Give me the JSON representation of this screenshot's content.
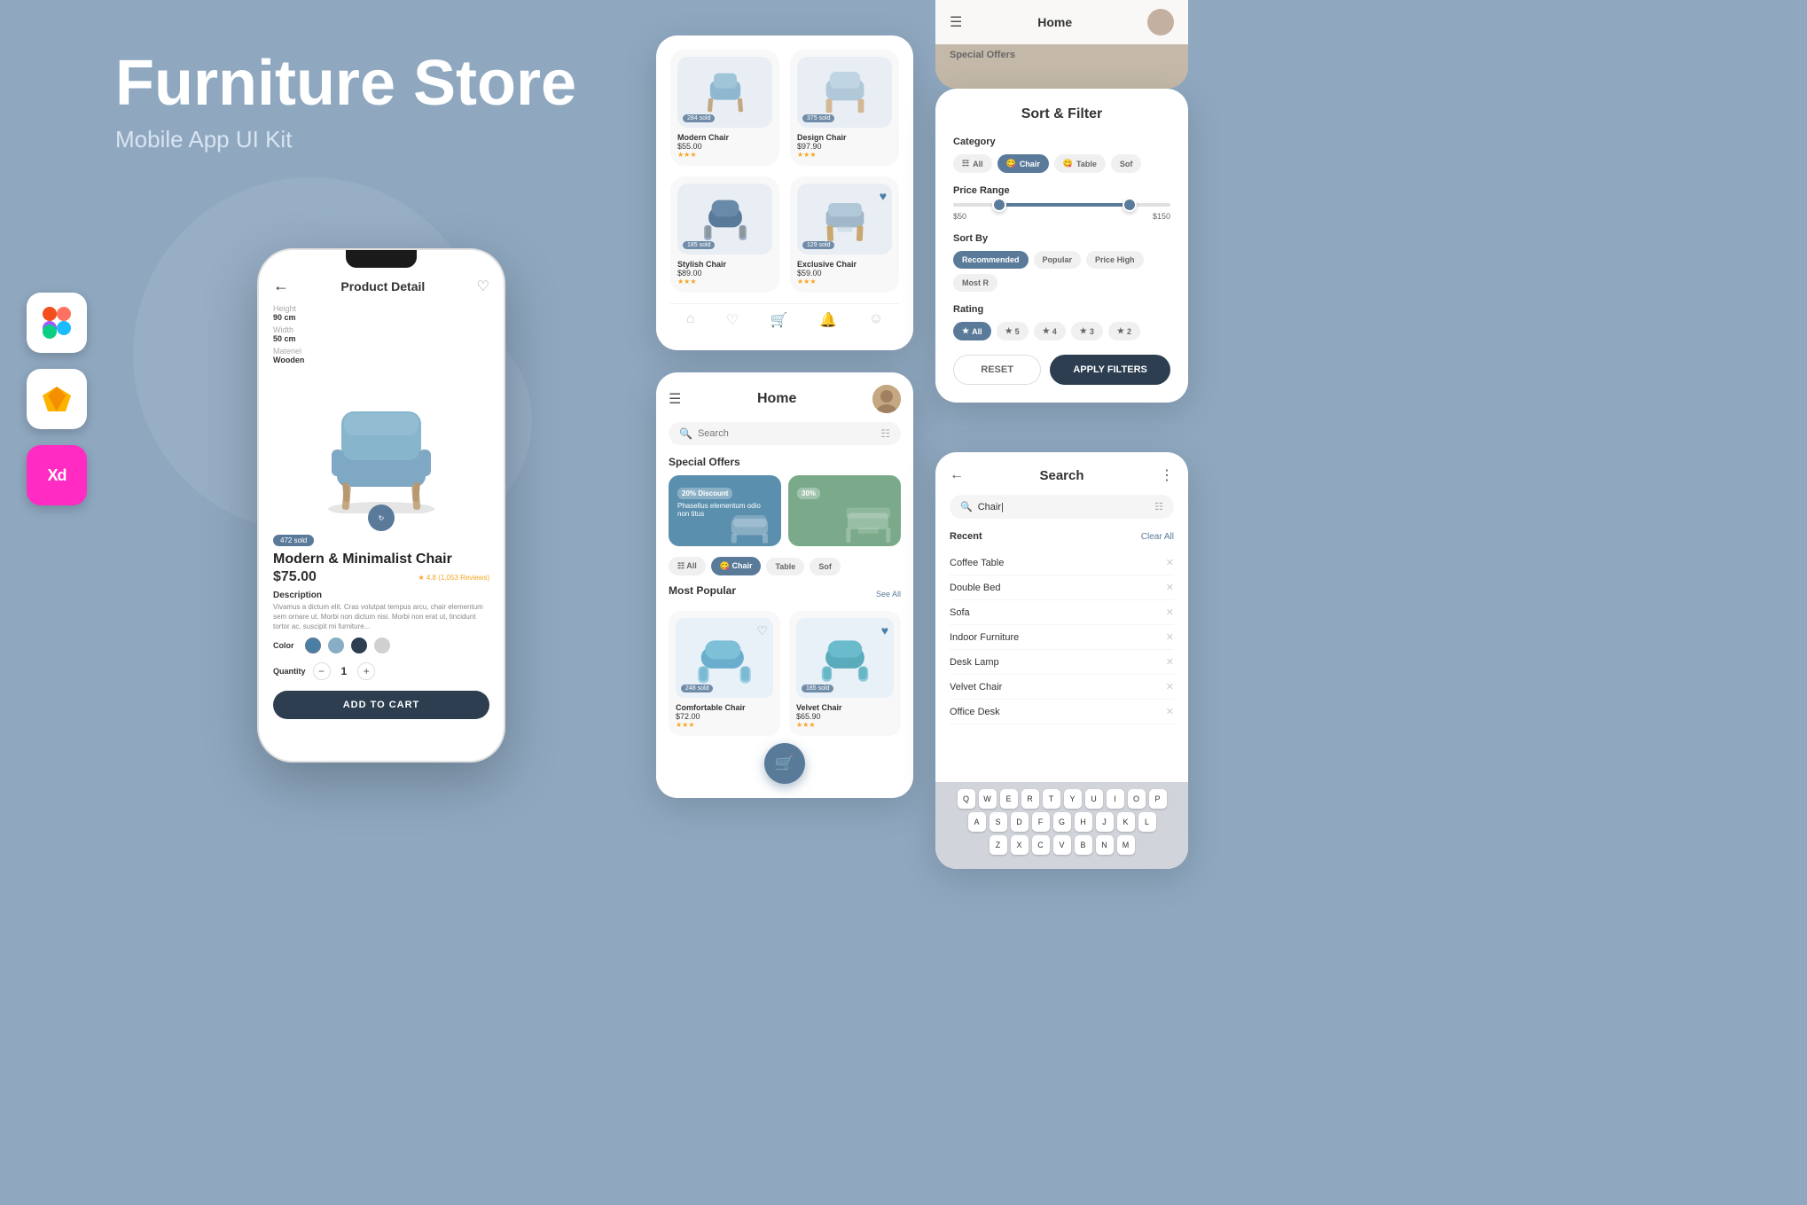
{
  "hero": {
    "title": "Furniture Store",
    "subtitle": "Mobile App UI Kit"
  },
  "appIcons": [
    {
      "name": "Figma",
      "type": "figma"
    },
    {
      "name": "Sketch",
      "type": "sketch"
    },
    {
      "name": "Adobe XD",
      "type": "xd",
      "label": "Xd"
    }
  ],
  "productDetail": {
    "title": "Product Detail",
    "specs": {
      "height_label": "Height",
      "height_value": "90 cm",
      "width_label": "Width",
      "width_value": "50 cm",
      "material_label": "Materiel",
      "material_value": "Wooden"
    },
    "sold": "472 sold",
    "name": "Modern & Minimalist Chair",
    "price": "$75.00",
    "rating": "4.8 (1,053 Reviews)",
    "description_title": "Description",
    "description": "Vivamus a dictum elit. Cras volutpat tempus arcu, chair elementum sem ornare ut. Morbi non dictum nisi. Morbi non erat ut, tincidunt tortor ac, suscipit mi furniture...",
    "color_label": "Color",
    "quantity_label": "Quantity",
    "quantity_value": "1",
    "add_to_cart": "ADD TO CART",
    "colors": [
      "#4a7fa5",
      "#87aec4",
      "#2c3e50",
      "#d0d0d0"
    ]
  },
  "productList": {
    "items": [
      {
        "sold": "284 sold",
        "name": "Modern Chair",
        "price": "$55.00",
        "stars": 3
      },
      {
        "sold": "375 sold",
        "name": "Design Chair",
        "price": "$97.90",
        "stars": 3
      },
      {
        "sold": "185 sold",
        "name": "Stylish Chair",
        "price": "$89.00",
        "stars": 3
      },
      {
        "sold": "129 sold",
        "name": "Exclusive Chair",
        "price": "$59.00",
        "stars": 3
      }
    ]
  },
  "homeScreen": {
    "title": "Home",
    "search_placeholder": "Search",
    "special_offers_label": "Special Offers",
    "most_popular_label": "Most Popular",
    "see_all": "See All",
    "offers": [
      {
        "badge": "20% Discount",
        "text": "Phasellus elementum odio non titus"
      },
      {
        "badge": "30%",
        "text": ""
      }
    ],
    "categories": [
      "All",
      "Chair",
      "Table",
      "Sof"
    ],
    "popular_items": [
      {
        "sold": "248 sold",
        "name": "Comfortable Chair",
        "price": "$72.00"
      },
      {
        "sold": "185 sold",
        "name": "Velvet Chair",
        "price": "$65.90"
      }
    ]
  },
  "sortFilter": {
    "title": "Sort & Filter",
    "category_label": "Category",
    "categories": [
      "All",
      "Chair",
      "Table",
      "Sof"
    ],
    "price_range_label": "Price Range",
    "price_min": "$50",
    "price_max": "$150",
    "sort_label": "Sort By",
    "sort_options": [
      "Recommended",
      "Popular",
      "Price High",
      "Most R"
    ],
    "rating_label": "Rating",
    "rating_options": [
      "All",
      "5",
      "4",
      "3",
      "2"
    ],
    "reset_label": "RESET",
    "apply_label": "APPLY FILTERS"
  },
  "searchScreen": {
    "title": "Search",
    "input_value": "Chair|",
    "recent_label": "Recent",
    "clear_all": "Clear All",
    "recent_items": [
      "Coffee Table",
      "Double Bed",
      "Sofa",
      "Indoor Furniture",
      "Desk Lamp",
      "Velvet Chair",
      "Office Desk"
    ],
    "keyboard_rows": [
      [
        "Q",
        "W",
        "E",
        "R",
        "T",
        "Y",
        "U",
        "I",
        "O",
        "P"
      ],
      [
        "A",
        "S",
        "D",
        "F",
        "G",
        "H",
        "J",
        "K",
        "L"
      ],
      [
        "Z",
        "X",
        "C",
        "V",
        "B",
        "N",
        "M"
      ]
    ]
  },
  "topMini": {
    "menu_icon": "≡",
    "home_label": "Home",
    "special_offers_label": "Special Offers"
  }
}
